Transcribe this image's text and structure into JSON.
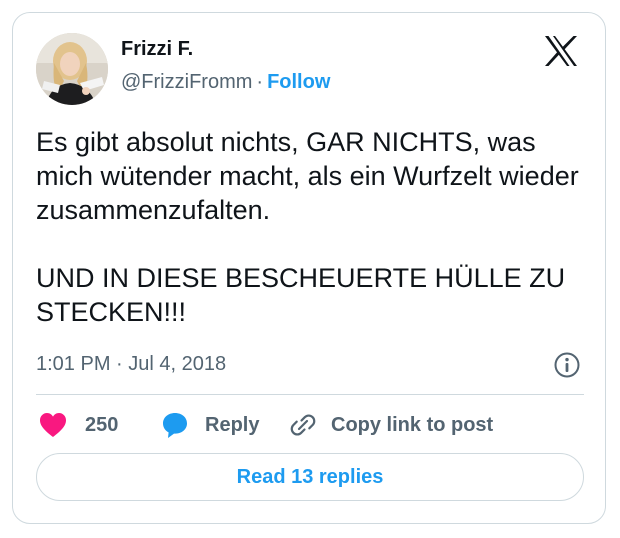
{
  "author": {
    "name": "Frizzi F.",
    "handle": "@FrizziFromm",
    "separator": "·",
    "follow_label": "Follow"
  },
  "tweet": {
    "text": "Es gibt absolut nichts, GAR NICHTS, was mich wütender macht, als ein Wurfzelt wieder zusammenzufalten.\n\nUND IN DIESE BESCHEUERTE HÜLLE ZU STECKEN!!!",
    "timestamp": "1:01 PM · Jul 4, 2018"
  },
  "actions": {
    "like_count": "250",
    "reply_label": "Reply",
    "copy_link_label": "Copy link to post"
  },
  "replies_button": {
    "label": "Read 13 replies"
  },
  "icons": {
    "brand": "x-logo-icon",
    "info": "info-icon",
    "like": "heart-icon",
    "reply": "speech-bubble-icon",
    "copy": "link-icon"
  },
  "colors": {
    "accent": "#1d9bf0",
    "like": "#f91880",
    "text": "#0f1419",
    "muted": "#536471",
    "border": "#cfd9de"
  }
}
